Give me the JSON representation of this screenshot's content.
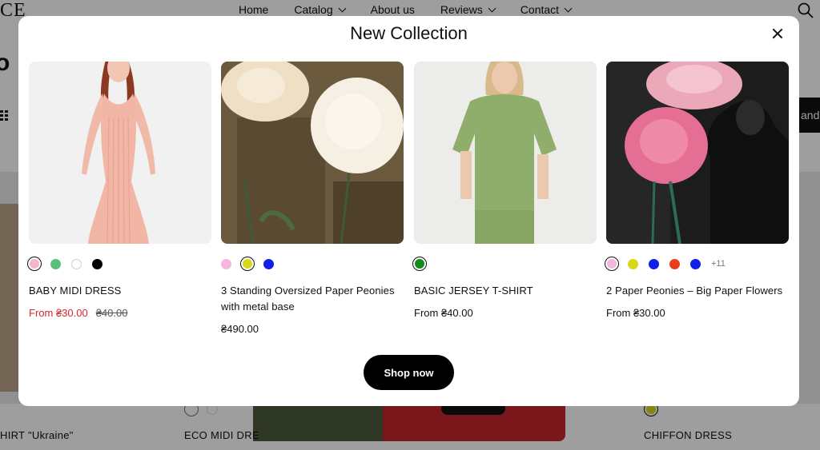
{
  "background": {
    "logo": "CE",
    "nav": [
      {
        "label": "Home",
        "dropdown": false
      },
      {
        "label": "Catalog",
        "dropdown": true
      },
      {
        "label": "About us",
        "dropdown": false
      },
      {
        "label": "Reviews",
        "dropdown": true
      },
      {
        "label": "Contact",
        "dropdown": true
      }
    ],
    "heading": "o",
    "side_button": "and",
    "bottom_labels": [
      "HIRT \"Ukraine\"",
      "ECO MIDI DRE",
      "CHIFFON DRESS"
    ]
  },
  "modal": {
    "title": "New Collection",
    "shop_button": "Shop now",
    "products": [
      {
        "name": "BABY MIDI DRESS",
        "price": "From ₴30.00",
        "old_price": "₴40.00",
        "on_sale": true,
        "swatches": [
          "#f5b6c8",
          "#5bbf7a",
          "#ffffff",
          "#000000"
        ],
        "selected_swatch": 0,
        "more": ""
      },
      {
        "name": "3 Standing Oversized Paper Peonies with metal base",
        "price": "₴490.00",
        "old_price": "",
        "on_sale": false,
        "swatches": [
          "#f4b6dc",
          "#d6d81a",
          "#1020e8"
        ],
        "selected_swatch": 1,
        "more": ""
      },
      {
        "name": "BASIC JERSEY T-SHIRT",
        "price": "From ₴40.00",
        "old_price": "",
        "on_sale": false,
        "swatches": [
          "#118b1d"
        ],
        "selected_swatch": 0,
        "more": ""
      },
      {
        "name": "2 Paper Peonies – Big Paper Flowers",
        "price": "From ₴30.00",
        "old_price": "",
        "on_sale": false,
        "swatches": [
          "#f4b6dc",
          "#d6d81a",
          "#1020e8",
          "#e8401a",
          "#1020e8"
        ],
        "selected_swatch": 0,
        "more": "+11"
      }
    ]
  }
}
